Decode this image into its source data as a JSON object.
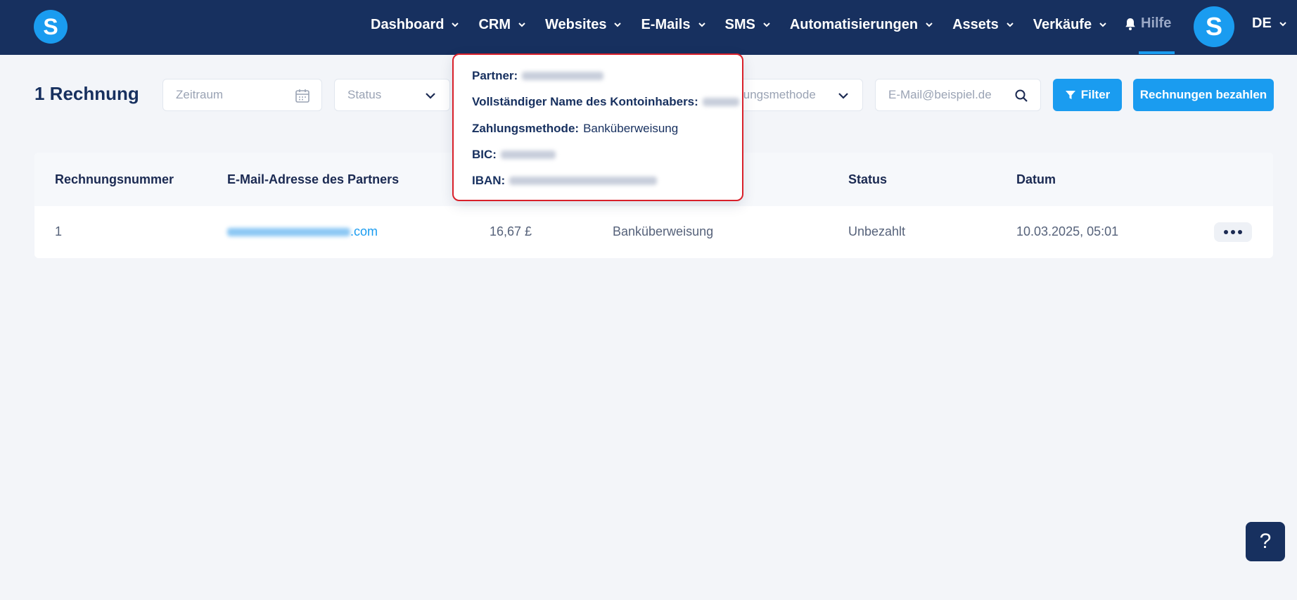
{
  "header": {
    "logo_letter": "S",
    "nav": [
      {
        "label": "Dashboard"
      },
      {
        "label": "CRM"
      },
      {
        "label": "Websites"
      },
      {
        "label": "E-Mails"
      },
      {
        "label": "SMS"
      },
      {
        "label": "Automatisierungen"
      },
      {
        "label": "Assets"
      },
      {
        "label": "Verkäufe"
      }
    ],
    "help_label": "Hilfe",
    "avatar_letter": "S",
    "language": "DE"
  },
  "page": {
    "title": "1 Rechnung"
  },
  "filters": {
    "period_placeholder": "Zeitraum",
    "status_placeholder": "Status",
    "payment_method_placeholder": "lungsmethode",
    "email_placeholder": "E-Mail@beispiel.de",
    "filter_button": "Filter",
    "pay_button": "Rechnungen bezahlen"
  },
  "table": {
    "headers": {
      "number": "Rechnungsnummer",
      "email": "E-Mail-Adresse des Partners",
      "status": "Status",
      "date": "Datum"
    },
    "rows": [
      {
        "number": "1",
        "email_suffix": ".com",
        "amount": "16,67 £",
        "payment_method": "Banküberweisung",
        "status": "Unbezahlt",
        "date": "10.03.2025, 05:01"
      }
    ]
  },
  "popover": {
    "partner_label": "Partner:",
    "account_holder_label": "Vollständiger Name des Kontoinhabers:",
    "payment_method_label": "Zahlungsmethode:",
    "payment_method_value": "Banküberweisung",
    "bic_label": "BIC:",
    "iban_label": "IBAN:"
  },
  "help_fab": "?",
  "colors": {
    "navbar": "#17305f",
    "accent": "#1a9cf0",
    "background": "#f3f5f9",
    "highlight_border": "#d9202a"
  }
}
